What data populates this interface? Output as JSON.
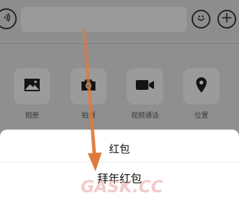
{
  "input_bar": {
    "voice_icon": "voice-wave-icon",
    "input_value": "",
    "emoji_icon": "smiley-icon",
    "plus_icon": "plus-icon"
  },
  "panel": {
    "items": [
      {
        "label": "相册",
        "icon": "image-icon"
      },
      {
        "label": "拍摄",
        "icon": "camera-icon"
      },
      {
        "label": "视频通话",
        "icon": "video-camera-icon"
      },
      {
        "label": "位置",
        "icon": "location-pin-icon"
      }
    ]
  },
  "sheet": {
    "options": [
      {
        "label": "红包"
      },
      {
        "label": "拜年红包"
      }
    ]
  },
  "annotation": {
    "arrow_color": "#e07a3a"
  },
  "watermark": {
    "text": "GASK.CC"
  }
}
